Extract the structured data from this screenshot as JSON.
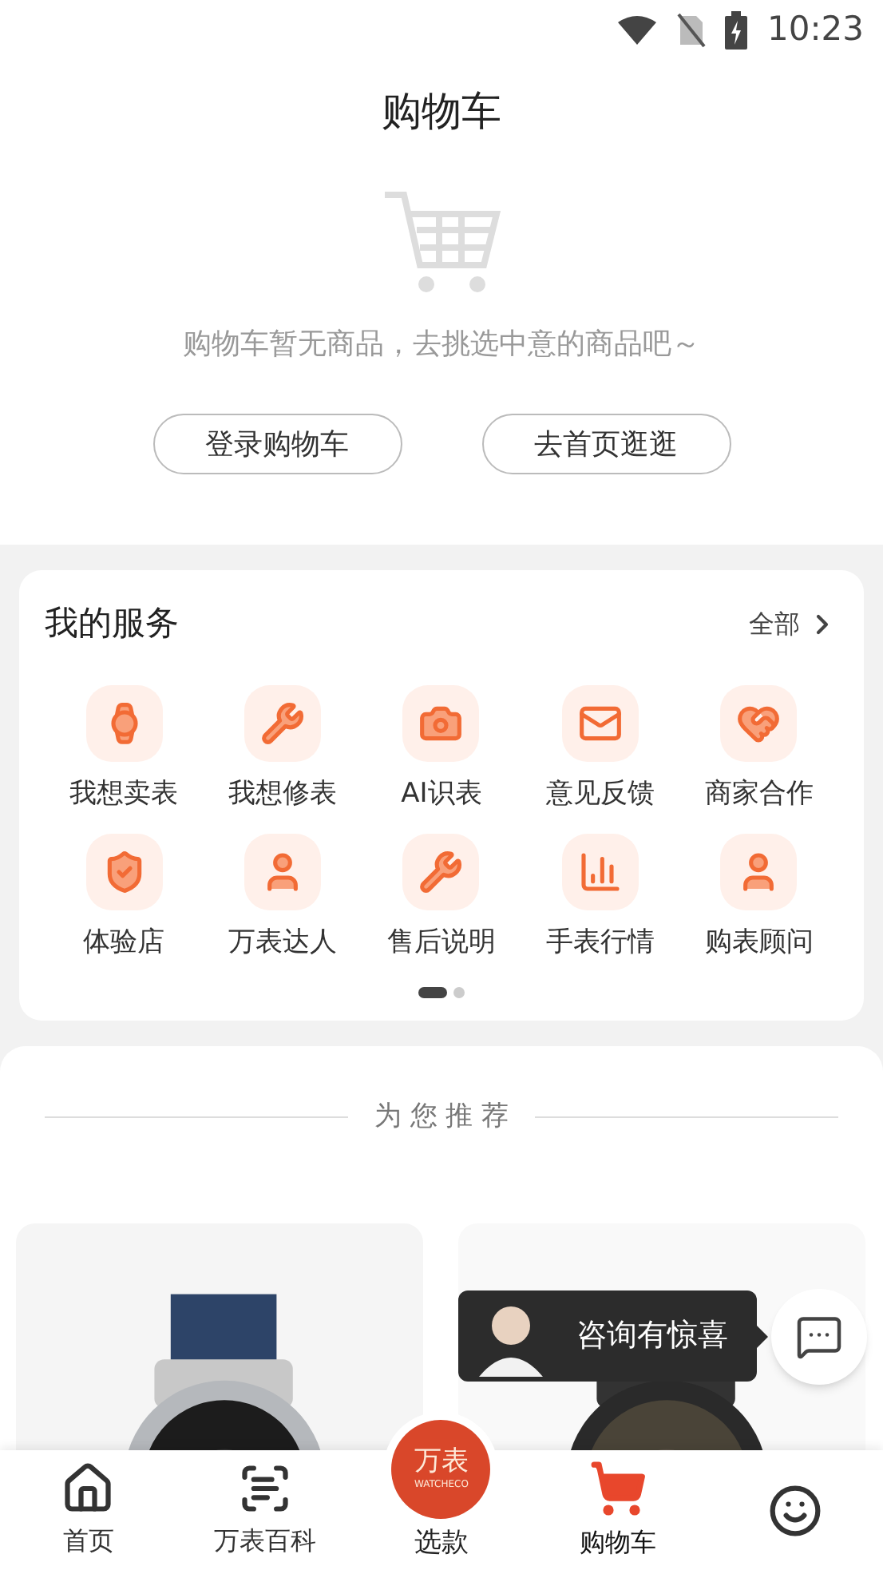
{
  "status_bar": {
    "time": "10:23"
  },
  "header": {
    "title": "购物车"
  },
  "empty_cart": {
    "message": "购物车暂无商品，去挑选中意的商品吧～",
    "buttons": [
      "登录购物车",
      "去首页逛逛"
    ]
  },
  "services": {
    "title": "我的服务",
    "more": "全部",
    "items": [
      {
        "label": "我想卖表",
        "kind": "watch"
      },
      {
        "label": "我想修表",
        "kind": "repair"
      },
      {
        "label": "AI识表",
        "kind": "ai"
      },
      {
        "label": "意见反馈",
        "kind": "mail"
      },
      {
        "label": "商家合作",
        "kind": "heart"
      },
      {
        "label": "体验店",
        "kind": "shield"
      },
      {
        "label": "万表达人",
        "kind": "person"
      },
      {
        "label": "售后说明",
        "kind": "wrench"
      },
      {
        "label": "手表行情",
        "kind": "chart"
      },
      {
        "label": "购表顾问",
        "kind": "person"
      }
    ],
    "pages": [
      {
        "selected": true
      },
      {
        "selected": false
      }
    ]
  },
  "recommend": {
    "title": "为 您 推 荐"
  },
  "consult": {
    "text": "咨询有惊喜"
  },
  "tab_bar": {
    "center_logo": "万表",
    "center_logo_sub": "WATCHECO",
    "tabs": [
      {
        "label": "首页",
        "kind": "home",
        "selected": false
      },
      {
        "label": "万表百科",
        "kind": "wiki",
        "selected": false
      },
      {
        "label": "选款",
        "kind": "center",
        "selected": false
      },
      {
        "label": "购物车",
        "kind": "cart",
        "selected": true
      },
      {
        "kind": "profile",
        "selected": false
      }
    ]
  }
}
